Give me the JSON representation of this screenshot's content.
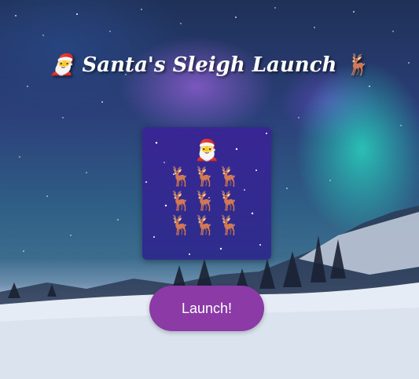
{
  "title": "🎅 Santa's Sleigh Launch 🦌",
  "board": {
    "santa": "🎅",
    "reindeer": [
      "🦌",
      "🦌",
      "🦌",
      "🦌",
      "🦌",
      "🦌",
      "🦌",
      "🦌",
      "🦌"
    ]
  },
  "launch_button": "Launch!"
}
